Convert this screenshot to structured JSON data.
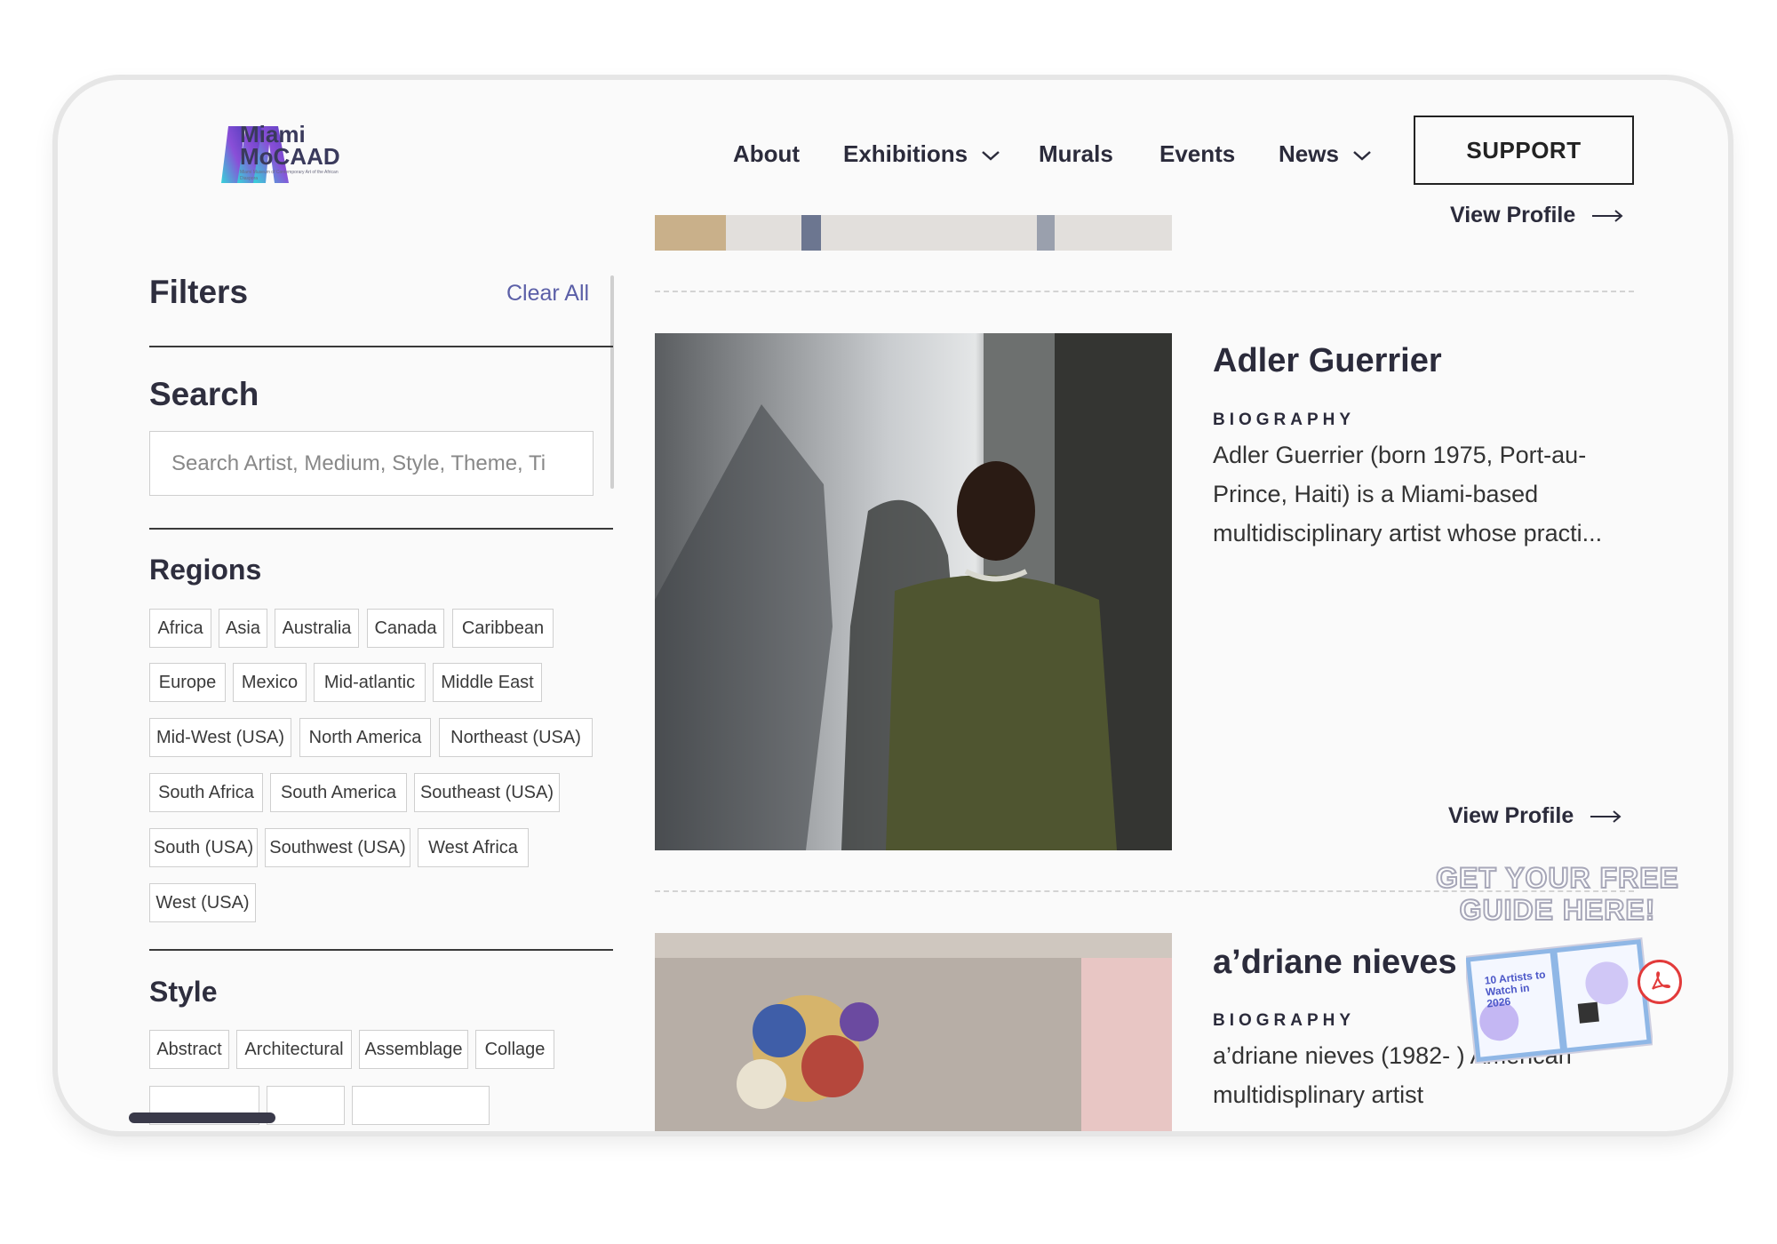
{
  "logo": {
    "line1": "Miami",
    "line2": "MoCAAD",
    "tagline": "Miami Museum of Contemporary Art of the African Diaspora"
  },
  "nav": {
    "items": [
      "About",
      "Exhibitions",
      "Murals",
      "Events",
      "News"
    ],
    "support": "SUPPORT"
  },
  "filters": {
    "title": "Filters",
    "clear_all": "Clear All",
    "search_title": "Search",
    "search_placeholder": "Search Artist, Medium, Style, Theme, Ti",
    "regions_title": "Regions",
    "regions": [
      "Africa",
      "Asia",
      "Australia",
      "Canada",
      "Caribbean",
      "Europe",
      "Mexico",
      "Mid-atlantic",
      "Middle East",
      "Mid-West (USA)",
      "North America",
      "Northeast (USA)",
      "South Africa",
      "South America",
      "Southeast (USA)",
      "South (USA)",
      "Southwest (USA)",
      "West Africa",
      "West (USA)"
    ],
    "style_title": "Style",
    "styles": [
      "Abstract",
      "Architectural",
      "Assemblage",
      "Collage"
    ]
  },
  "cards": {
    "view_profile": "View Profile",
    "bio_label": "BIOGRAPHY",
    "artists": [
      {
        "name": "Adler Guerrier",
        "bio": "Adler Guerrier (born 1975, Port-au-Prince, Haiti) is a Miami-based multidisciplinary artist whose practi..."
      },
      {
        "name": "a’driane nieves",
        "bio": "a’driane nieves (1982- ) American multidisplinary artist"
      }
    ]
  },
  "promo": {
    "line1": "GET YOUR FREE",
    "line2": "GUIDE HERE!",
    "book_title": "10 Artists to Watch in 2026"
  },
  "colors": {
    "accent_link": "#5b5fa7",
    "logo_gradient": [
      "#35d3d9",
      "#8a4fd8",
      "#5a3fc0"
    ]
  }
}
